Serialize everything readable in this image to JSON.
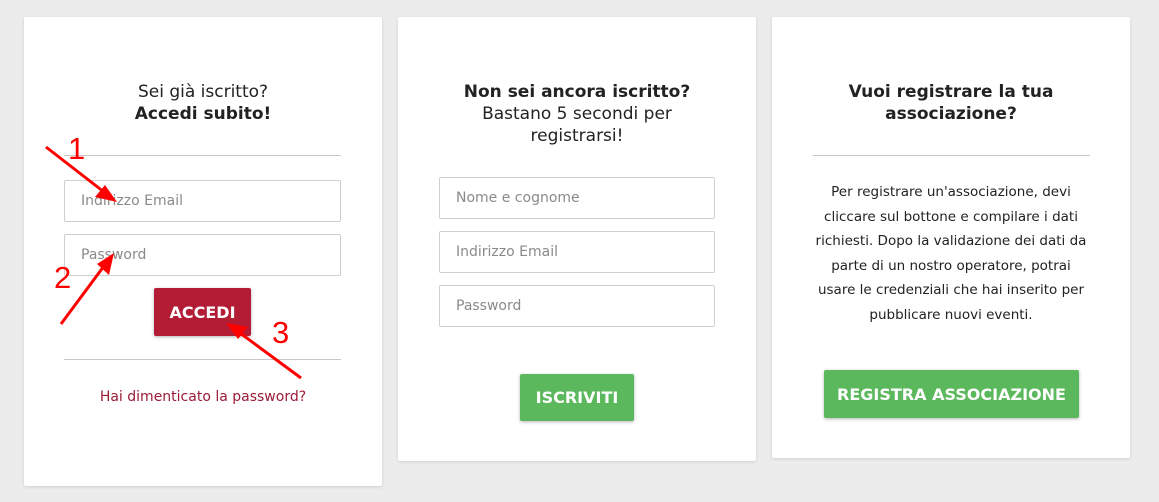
{
  "login": {
    "title_line1": "Sei già iscritto?",
    "title_line2": "Accedi subito!",
    "email_placeholder": "Indirizzo Email",
    "password_placeholder": "Password",
    "submit_label": "ACCEDI",
    "forgot_link": "Hai dimenticato la password?"
  },
  "register": {
    "title_line1": "Non sei ancora iscritto?",
    "title_line2": "Bastano 5 secondi per",
    "title_line3": "registrarsi!",
    "name_placeholder": "Nome e cognome",
    "email_placeholder": "Indirizzo Email",
    "password_placeholder": "Password",
    "submit_label": "ISCRIVITI"
  },
  "association": {
    "title_line1": "Vuoi registrare la tua",
    "title_line2": "associazione?",
    "description": "Per registrare un'associazione, devi cliccare sul bottone e compilare i dati richiesti. Dopo la validazione dei dati da parte di un nostro operatore, potrai usare le credenziali che hai inserito per pubblicare nuovi eventi.",
    "submit_label": "REGISTRA ASSOCIAZIONE"
  },
  "annotations": {
    "label_1": "1",
    "label_2": "2",
    "label_3": "3",
    "color": "#ff0000"
  },
  "colors": {
    "primary_red": "#b31c35",
    "success_green": "#5cb85c",
    "link_red": "#9b1b35"
  }
}
